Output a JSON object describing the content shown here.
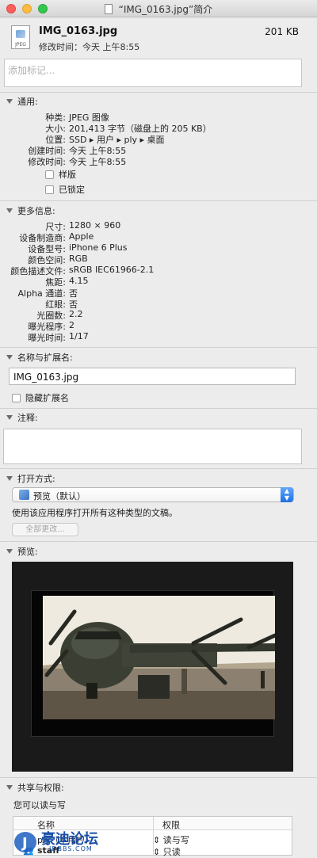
{
  "window": {
    "title": "“IMG_0163.jpg”简介"
  },
  "header": {
    "file_name": "IMG_0163.jpg",
    "file_size": "201 KB",
    "modified": "修改时间：今天 上午8:55",
    "file_icon": "jpeg-file-icon",
    "icon_caption": "JPEG"
  },
  "tags": {
    "placeholder": "添加标记..."
  },
  "general": {
    "heading": "通用:",
    "rows": [
      {
        "key": "种类:",
        "value": "JPEG 图像"
      },
      {
        "key": "大小:",
        "value": "201,413 字节（磁盘上的 205 KB）"
      },
      {
        "key": "位置:",
        "value": "SSD ▸ 用户 ▸ ply ▸ 桌面"
      },
      {
        "key": "创建时间:",
        "value": "今天 上午8:55"
      },
      {
        "key": "修改时间:",
        "value": "今天 上午8:55"
      }
    ],
    "stationery_label": "样版",
    "locked_label": "已锁定",
    "stationery_checked": false,
    "locked_checked": false
  },
  "more_info": {
    "heading": "更多信息:",
    "rows": [
      {
        "key": "尺寸:",
        "value": "1280 × 960"
      },
      {
        "key": "设备制造商:",
        "value": "Apple"
      },
      {
        "key": "设备型号:",
        "value": "iPhone 6 Plus"
      },
      {
        "key": "颜色空间:",
        "value": "RGB"
      },
      {
        "key": "颜色描述文件:",
        "value": "sRGB IEC61966-2.1"
      },
      {
        "key": "焦距:",
        "value": "4.15"
      },
      {
        "key": "Alpha 通道:",
        "value": "否"
      },
      {
        "key": "红眼:",
        "value": "否"
      },
      {
        "key": "光圈数:",
        "value": "2.2"
      },
      {
        "key": "曝光程序:",
        "value": "2"
      },
      {
        "key": "曝光时间:",
        "value": "1/17"
      }
    ]
  },
  "name_ext": {
    "heading": "名称与扩展名:",
    "value": "IMG_0163.jpg",
    "hide_ext_label": "隐藏扩展名",
    "hide_ext_checked": false
  },
  "comments": {
    "heading": "注释:",
    "value": ""
  },
  "open_with": {
    "heading": "打开方式:",
    "selected_app": "预览（默认）",
    "hint": "使用该应用程序打开所有这种类型的文稿。",
    "change_all_label": "全部更改..."
  },
  "preview": {
    "heading": "预览:"
  },
  "sharing": {
    "heading": "共享与权限:",
    "summary": "您可以读与写",
    "col_name": "名称",
    "col_privilege": "权限",
    "rows": [
      {
        "name": "ply（本用户）",
        "privilege": "读与写"
      },
      {
        "name": "staff",
        "privilege": "只读"
      }
    ]
  },
  "watermark": {
    "text": "豪迪论坛",
    "sub": "JDBBS.COM"
  },
  "colors": {
    "accent": "#1f6fe3",
    "window_bg": "#ececec"
  }
}
